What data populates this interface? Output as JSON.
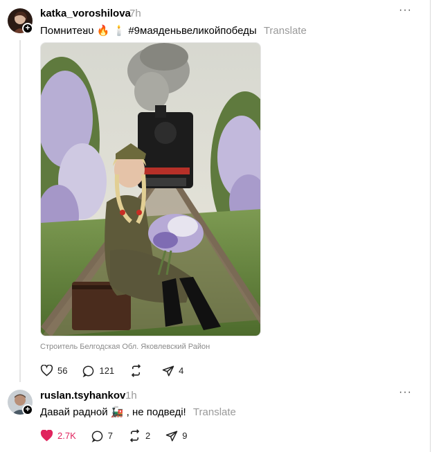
{
  "post": {
    "username": "katka_voroshilova",
    "time": "7h",
    "text": "Помнитеᴚᴜ 🔥 🕯️ #9маяденьвеликойпобеды",
    "translate": "Translate",
    "location": "Строитель Белгодская Обл. Яковлевский Район",
    "actions": {
      "likes": "56",
      "comments": "121",
      "reposts": "",
      "shares": "4"
    }
  },
  "reply": {
    "username": "ruslan.tsyhankov",
    "time": "1h",
    "text": "Давай радной 🚂 , не подведі!",
    "translate": "Translate",
    "actions": {
      "likes": "2.7K",
      "comments": "7",
      "reposts": "2",
      "shares": "9"
    }
  },
  "colors": {
    "like": "#e0245e",
    "muted": "#999999"
  }
}
